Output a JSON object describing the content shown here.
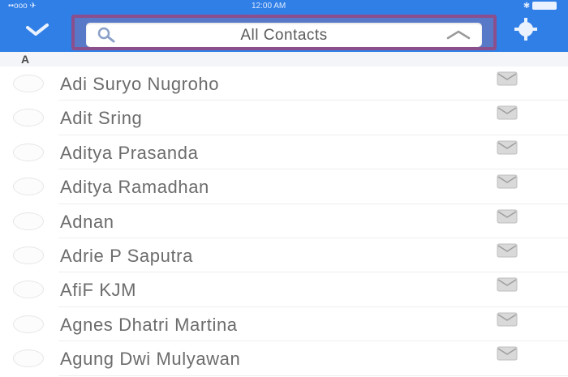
{
  "statusbar": {
    "left": "••ooo ✈",
    "time": "12:00 AM",
    "right": "✱"
  },
  "toolbar": {
    "select_icon": "checkmark-icon",
    "add_icon": "add-contact-icon",
    "filter_title": "All Contacts"
  },
  "section": {
    "letter": "A"
  },
  "contacts": [
    {
      "name": "Adi Suryo Nugroho"
    },
    {
      "name": "Adit Sring"
    },
    {
      "name": "Aditya Prasanda"
    },
    {
      "name": "Aditya Ramadhan"
    },
    {
      "name": "Adnan"
    },
    {
      "name": "Adrie P Saputra"
    },
    {
      "name": "AfiF KJM"
    },
    {
      "name": "Agnes Dhatri Martina"
    },
    {
      "name": "Agung Dwi Mulyawan"
    }
  ],
  "colors": {
    "navbar": "#2f7fe6",
    "highlight_border": "#8a4f8c"
  }
}
